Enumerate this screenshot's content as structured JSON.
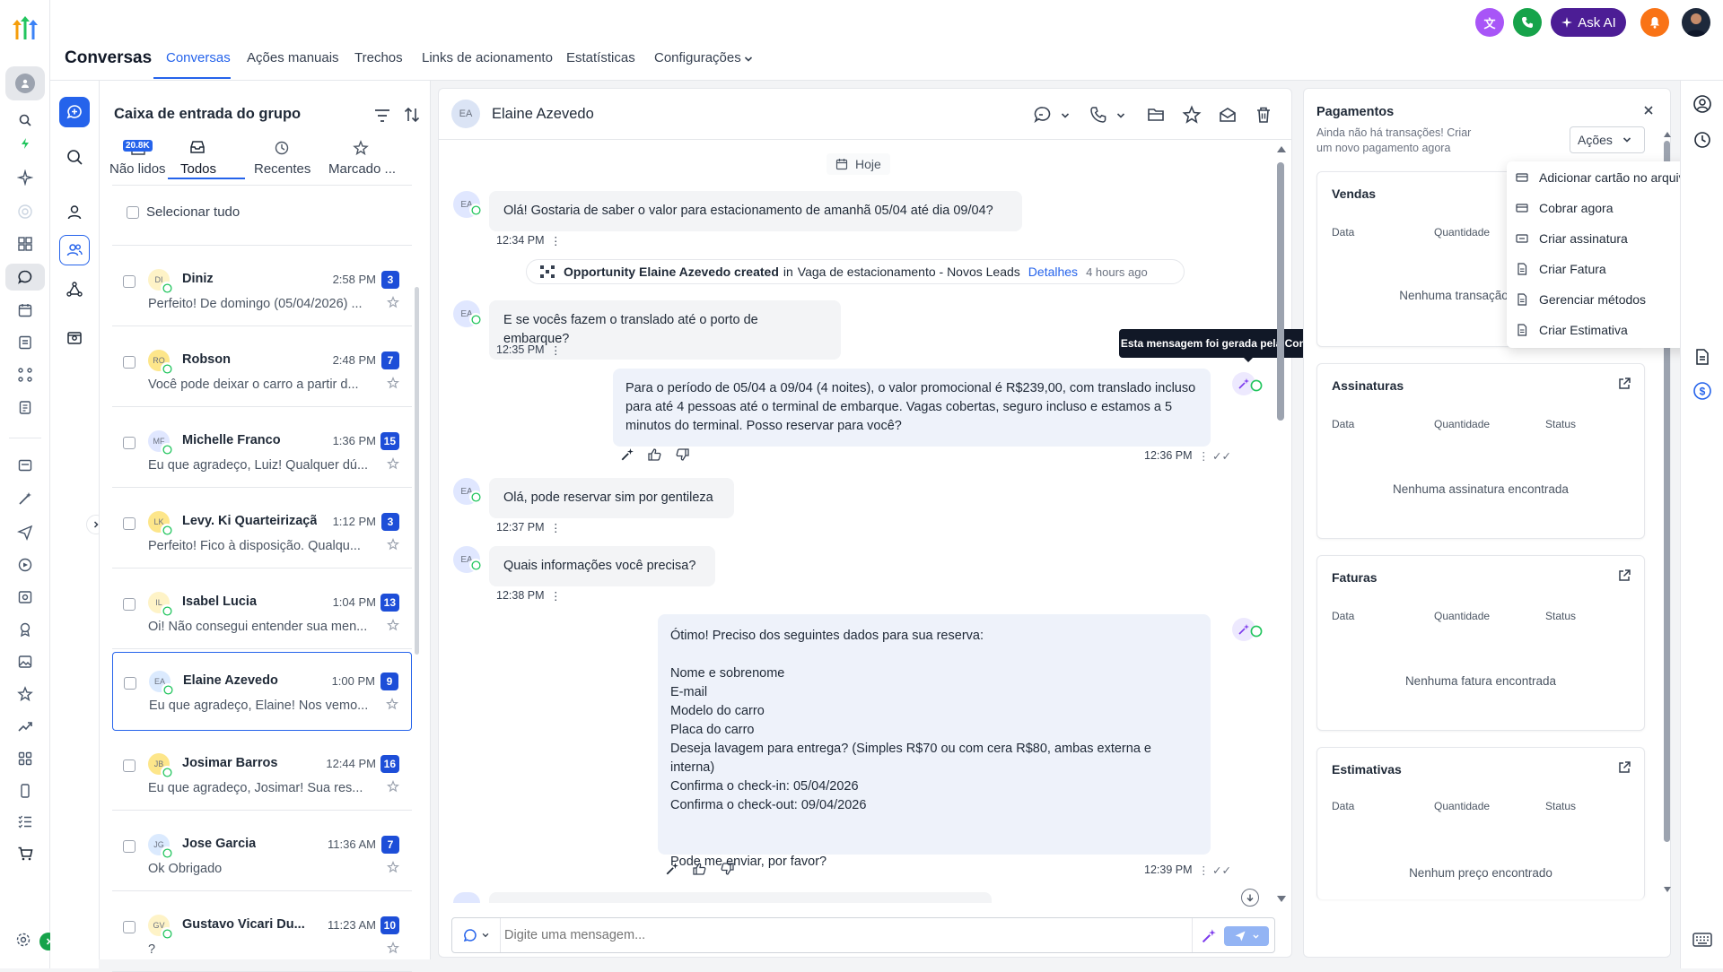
{
  "app": {
    "title": "Conversas"
  },
  "tabs": [
    "Conversas",
    "Ações manuais",
    "Trechos",
    "Links de acionamento",
    "Estatísticas",
    "Configurações"
  ],
  "top_actions": {
    "ask_ai": "Ask AI"
  },
  "inbox": {
    "title": "Caixa de entrada do grupo",
    "filters": [
      {
        "label": "Não lidos",
        "badge": "20.8K"
      },
      {
        "label": "Todos"
      },
      {
        "label": "Recentes"
      },
      {
        "label": "Marcado ..."
      }
    ],
    "select_all": "Selecionar tudo",
    "conversations": [
      {
        "initials": "DI",
        "name": "Diniz",
        "time": "2:58 PM",
        "count": "3",
        "preview": "Perfeito! De domingo (05/04/2026) ..."
      },
      {
        "initials": "RO",
        "name": "Robson",
        "time": "2:48 PM",
        "count": "7",
        "preview": "Você pode deixar o carro a partir d..."
      },
      {
        "initials": "MF",
        "name": "Michelle Franco",
        "time": "1:36 PM",
        "count": "15",
        "preview": "Eu que agradeço, Luiz! Qualquer dú..."
      },
      {
        "initials": "LK",
        "name": "Levy. Ki Quarteirização",
        "time": "1:12 PM",
        "count": "3",
        "preview": "Perfeito! Fico à disposição. Qualqu..."
      },
      {
        "initials": "IL",
        "name": "Isabel Lucia",
        "time": "1:04 PM",
        "count": "13",
        "preview": "Oi! Não consegui entender sua men..."
      },
      {
        "initials": "EA",
        "name": "Elaine Azevedo",
        "time": "1:00 PM",
        "count": "9",
        "preview": "Eu que agradeço, Elaine! Nos vemo..."
      },
      {
        "initials": "JB",
        "name": "Josimar Barros",
        "time": "12:44 PM",
        "count": "16",
        "preview": "Eu que agradeço, Josimar! Sua res..."
      },
      {
        "initials": "JG",
        "name": "Jose Garcia",
        "time": "11:36 AM",
        "count": "7",
        "preview": "Ok Obrigado"
      },
      {
        "initials": "GV",
        "name": "Gustavo Vicari Du...",
        "time": "11:23 AM",
        "count": "10",
        "preview": "?"
      }
    ]
  },
  "chat": {
    "contact_initials": "EA",
    "contact_name": "Elaine Azevedo",
    "date_chip": "Hoje",
    "messages": [
      {
        "text": "Olá! Gostaria de saber o valor para estacionamento de amanhã 05/04 até dia 09/04?",
        "time": "12:34 PM"
      },
      {
        "text": "E se vocês fazem o translado até o porto de embarque?",
        "time": "12:35 PM"
      },
      {
        "text": "Para o período de 05/04 a 09/04 (4 noites), o valor promocional é R$239,00, com translado incluso para até 4 pessoas até o terminal de embarque. Vagas cobertas, seguro incluso e estamos a 5 minutos do terminal. Posso reservar para você?",
        "time": "12:36 PM"
      },
      {
        "text": "Olá, pode reservar sim por gentileza",
        "time": "12:37 PM"
      },
      {
        "text": "Quais informações você precisa?",
        "time": "12:38 PM"
      },
      {
        "lines": [
          "Ótimo! Preciso dos seguintes dados para sua reserva:",
          "",
          "Nome e sobrenome",
          "E-mail",
          "Modelo do carro",
          "Placa do carro",
          "Deseja lavagem para entrega? (Simples R$70 ou com cera R$80, ambas externa e interna)",
          "Confirma o check-in: 05/04/2026",
          "Confirma o check-out: 09/04/2026",
          "",
          "",
          "Pode me enviar, por favor?"
        ],
        "time": "12:39 PM"
      }
    ],
    "activity": {
      "strong": "Opportunity Elaine Azevedo created",
      "middle": "in",
      "pipeline": "Vaga de estacionamento - Novos Leads",
      "link": "Detalhes",
      "ago": "4 hours ago"
    },
    "tooltip": "Esta mensagem foi gerada pela Conversation AI",
    "composer_placeholder": "Digite uma mensagem..."
  },
  "payments": {
    "title": "Pagamentos",
    "subtitle_1": "Ainda não há transações! Criar",
    "subtitle_2": "um novo pagamento agora",
    "actions_label": "Ações",
    "menu": [
      "Adicionar cartão no arquivo",
      "Cobrar agora",
      "Criar assinatura",
      "Criar Fatura",
      "Gerenciar métodos",
      "Criar Estimativa"
    ],
    "col_data": "Data",
    "col_qty": "Quantidade",
    "col_status": "Status",
    "cards": [
      {
        "title": "Vendas",
        "empty": "Nenhuma transação"
      },
      {
        "title": "Assinaturas",
        "empty": "Nenhuma assinatura encontrada"
      },
      {
        "title": "Faturas",
        "empty": "Nenhuma fatura encontrada"
      },
      {
        "title": "Estimativas",
        "empty": "Nenhum preço encontrado"
      }
    ]
  },
  "colors": {
    "accent": "#2563eb",
    "badge": "#1d4ed8",
    "whatsapp": "#22c55e",
    "ask_ai": "#4c1d95"
  }
}
